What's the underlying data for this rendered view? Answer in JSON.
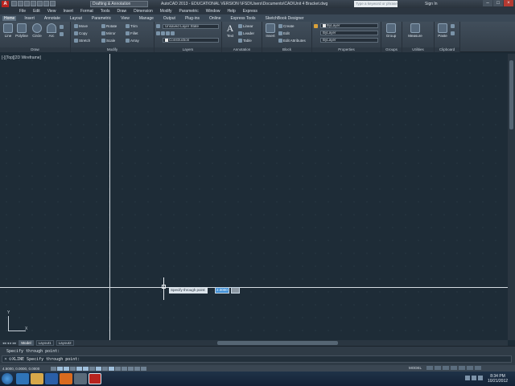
{
  "window": {
    "workspace": "Drafting & Annotation",
    "title": "AutoCAD 2013 - EDUCATIONAL VERSION   \\\\FSD\\Users\\Documents\\CAD\\Unit 4 Bracket.dwg",
    "search_placeholder": "Type a keyword or phrase",
    "signin": "Sign In"
  },
  "menubar": [
    "File",
    "Edit",
    "View",
    "Insert",
    "Format",
    "Tools",
    "Draw",
    "Dimension",
    "Modify",
    "Parametric",
    "Window",
    "Help",
    "Express"
  ],
  "tabs": [
    "Home",
    "Insert",
    "Annotate",
    "Layout",
    "Parametric",
    "View",
    "Manage",
    "Output",
    "Plug-ins",
    "Online",
    "Express Tools",
    "SketchBook Designer"
  ],
  "active_tab": "Home",
  "ribbon": {
    "draw": {
      "title": "Draw",
      "line": "Line",
      "polyline": "Polyline",
      "circle": "Circle",
      "arc": "Arc"
    },
    "modify": {
      "title": "Modify",
      "move": "Move",
      "rotate": "Rotate",
      "trim": "Trim",
      "copy": "Copy",
      "mirror": "Mirror",
      "fillet": "Fillet",
      "stretch": "Stretch",
      "scale": "Scale",
      "array": "Array"
    },
    "layers": {
      "title": "Layers",
      "state": "Unsaved Layer State",
      "current": "Construction"
    },
    "annotation": {
      "title": "Annotation",
      "text": "Text",
      "linear": "Linear",
      "leader": "Leader",
      "table": "Table"
    },
    "block": {
      "title": "Block",
      "insert": "Insert",
      "create": "Create",
      "edit": "Edit",
      "edit_attributes": "Edit Attributes"
    },
    "properties": {
      "title": "Properties",
      "color": "ByLayer",
      "linetype": "ByLayer",
      "lineweight": "ByLayer"
    },
    "groups": {
      "title": "Groups",
      "group": "Group"
    },
    "utilities": {
      "title": "Utilities",
      "measure": "Measure"
    },
    "clipboard": {
      "title": "Clipboard",
      "paste": "Paste"
    }
  },
  "viewport": {
    "label": "[-][Top][2D Wireframe]"
  },
  "ucs": {
    "x": "X",
    "y": "Y"
  },
  "prompt": {
    "text": "Specify through point:",
    "value": "2.0000"
  },
  "layout_tabs": [
    "Model",
    "Layout1",
    "Layout2"
  ],
  "active_layout": "Model",
  "command": {
    "history": "Specify through point:",
    "line": "XLINE Specify through point:"
  },
  "status": {
    "coords": "4.5000, 0.0000, 0.0000",
    "space": "MODEL"
  },
  "taskbar": {
    "time": "8:34 PM",
    "date": "10/21/2012"
  },
  "colors": {
    "canvas": "#1e2c37",
    "ribbon": "#3a4856",
    "accent": "#3f8fd6"
  }
}
